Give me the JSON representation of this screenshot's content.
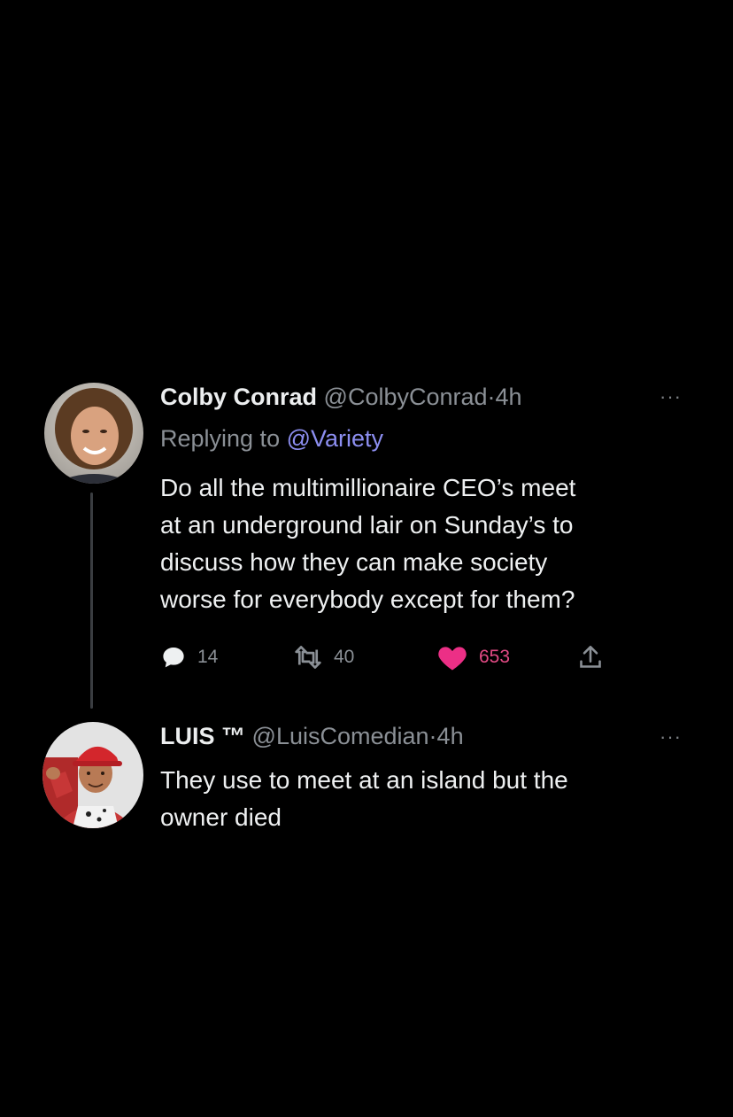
{
  "tweets": [
    {
      "name": "Colby Conrad",
      "handle": "@ColbyConrad",
      "separator": "·",
      "time": "4h",
      "more": "···",
      "replying_prefix": "Replying to",
      "replying_to": "@Variety",
      "text_lines": [
        "Do all the multimillionaire CEO’s meet",
        "at an underground lair on Sunday’s to",
        "discuss how they can make society",
        "worse for everybody except for them?"
      ],
      "actions": {
        "reply_count": "14",
        "retweet_count": "40",
        "like_count": "653",
        "liked": true
      },
      "icons": [
        "reply-icon",
        "retweet-icon",
        "heart-icon",
        "share-icon",
        "more-icon"
      ]
    },
    {
      "name": "LUIS ™",
      "handle": "@LuisComedian",
      "separator": "·",
      "time": "4h",
      "more": "···",
      "text_lines": [
        "They use to meet at an island but the",
        "owner died"
      ]
    }
  ],
  "colors": {
    "background": "#000000",
    "text": "#e7e9ea",
    "muted": "#8b9096",
    "mention": "#8c8ef0",
    "like": "#e24a84"
  }
}
